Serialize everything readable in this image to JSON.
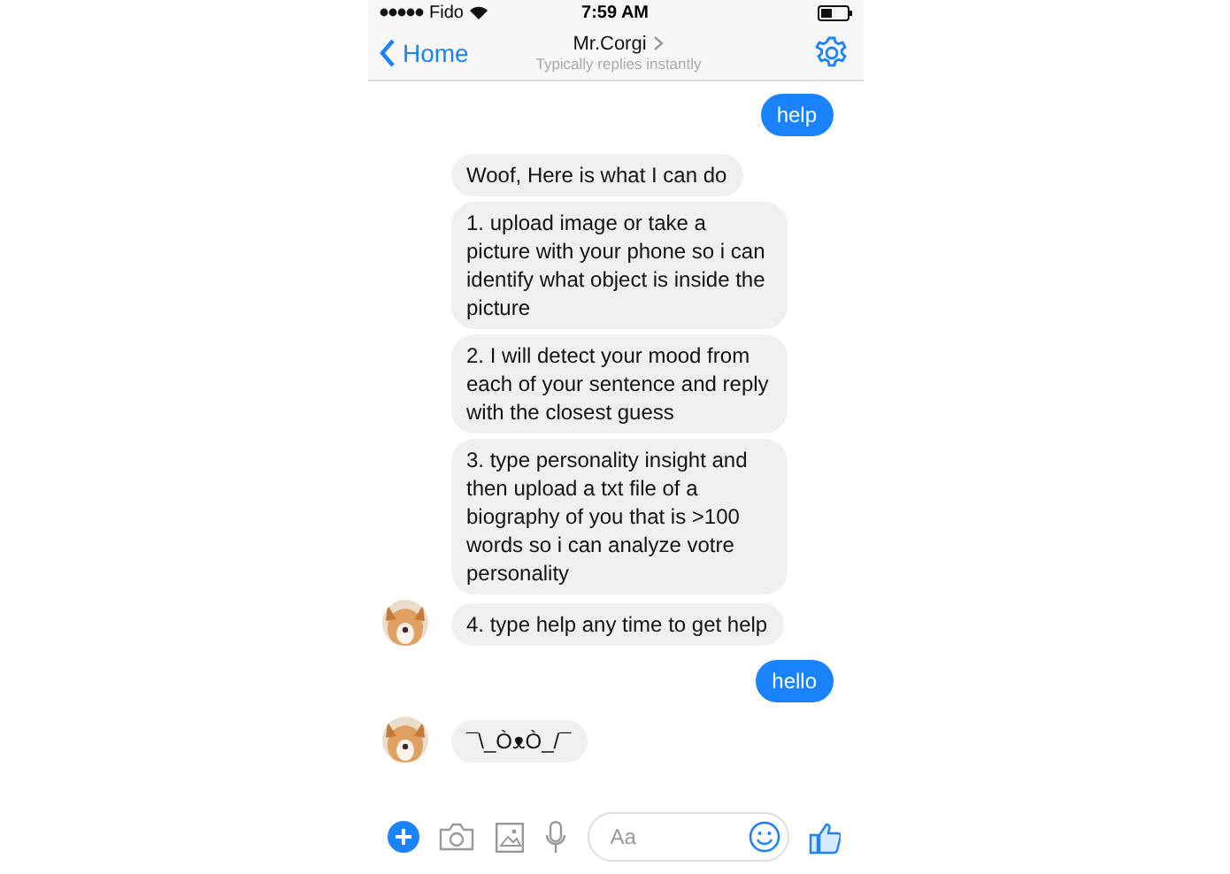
{
  "status_bar": {
    "carrier": "Fido",
    "time": "7:59 AM"
  },
  "nav": {
    "back": "Home",
    "title": "Mr.Corgi",
    "subtitle": "Typically replies instantly"
  },
  "messages": [
    {
      "kind": "sent",
      "text": "help"
    },
    {
      "kind": "received",
      "text": "Woof, Here is what I can do",
      "avatar": false
    },
    {
      "kind": "received",
      "text": "1. upload image or take a picture with your phone so i can identify what object is inside the picture",
      "avatar": false
    },
    {
      "kind": "received",
      "text": "2. I will detect your mood from each of your sentence and reply with the closest guess",
      "avatar": false
    },
    {
      "kind": "received",
      "text": "3. type personality insight and then upload a txt file of a biography of you that is >100 words so i can analyze votre personality",
      "avatar": false
    },
    {
      "kind": "received",
      "text": "4. type help any time to get help",
      "avatar": true
    },
    {
      "kind": "sent",
      "text": "hello"
    },
    {
      "kind": "received",
      "text": "¯\\_ÒᴥÒ_/¯",
      "avatar": true
    }
  ],
  "composer": {
    "placeholder": "Aa"
  }
}
